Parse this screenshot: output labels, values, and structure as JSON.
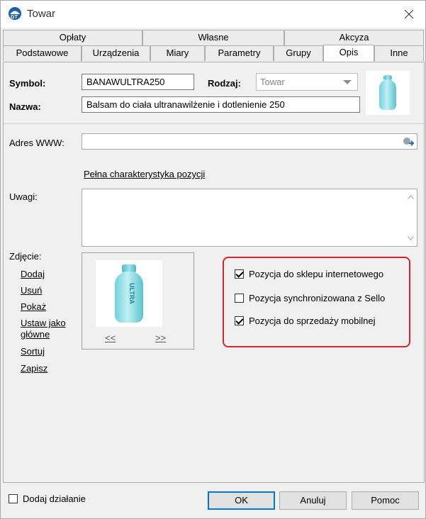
{
  "window": {
    "title": "Towar"
  },
  "tabs": {
    "top": [
      "Opłaty",
      "Własne",
      "Akcyza"
    ],
    "bottom": [
      "Podstawowe",
      "Urządzenia",
      "Miary",
      "Parametry",
      "Grupy",
      "Opis",
      "Inne"
    ],
    "active": "Opis"
  },
  "form": {
    "symbol_label": "Symbol:",
    "symbol_value": "BANAWULTRA250",
    "rodzaj_label": "Rodzaj:",
    "rodzaj_value": "Towar",
    "nazwa_label": "Nazwa:",
    "nazwa_value": "Balsam do ciała ultranawilżenie i dotlenienie 250",
    "www_label": "Adres WWW:",
    "www_value": "",
    "full_desc_link": "Pełna charakterystyka pozycji",
    "uwagi_label": "Uwagi:",
    "zdjecie_label": "Zdjęcie:"
  },
  "photo_actions": [
    "Dodaj",
    "Usuń",
    "Pokaż",
    "Ustaw jako główne",
    "Sortuj",
    "Zapisz"
  ],
  "photo_nav": {
    "prev": "<<",
    "next": ">>"
  },
  "bottle_text": "ULTRA",
  "checkboxes": [
    {
      "label": "Pozycja do sklepu internetowego",
      "checked": true
    },
    {
      "label": "Pozycja synchronizowana z Sello",
      "checked": false
    },
    {
      "label": "Pozycja do sprzedaży mobilnej",
      "checked": true
    }
  ],
  "footer": {
    "dodaj_dzialanie": "Dodaj działanie",
    "dodaj_dzialanie_checked": false,
    "ok": "OK",
    "anuluj": "Anuluj",
    "pomoc": "Pomoc"
  },
  "colors": {
    "highlight": "#d9232e",
    "accent": "#0078d7",
    "bottle": "#6fd3dc"
  }
}
